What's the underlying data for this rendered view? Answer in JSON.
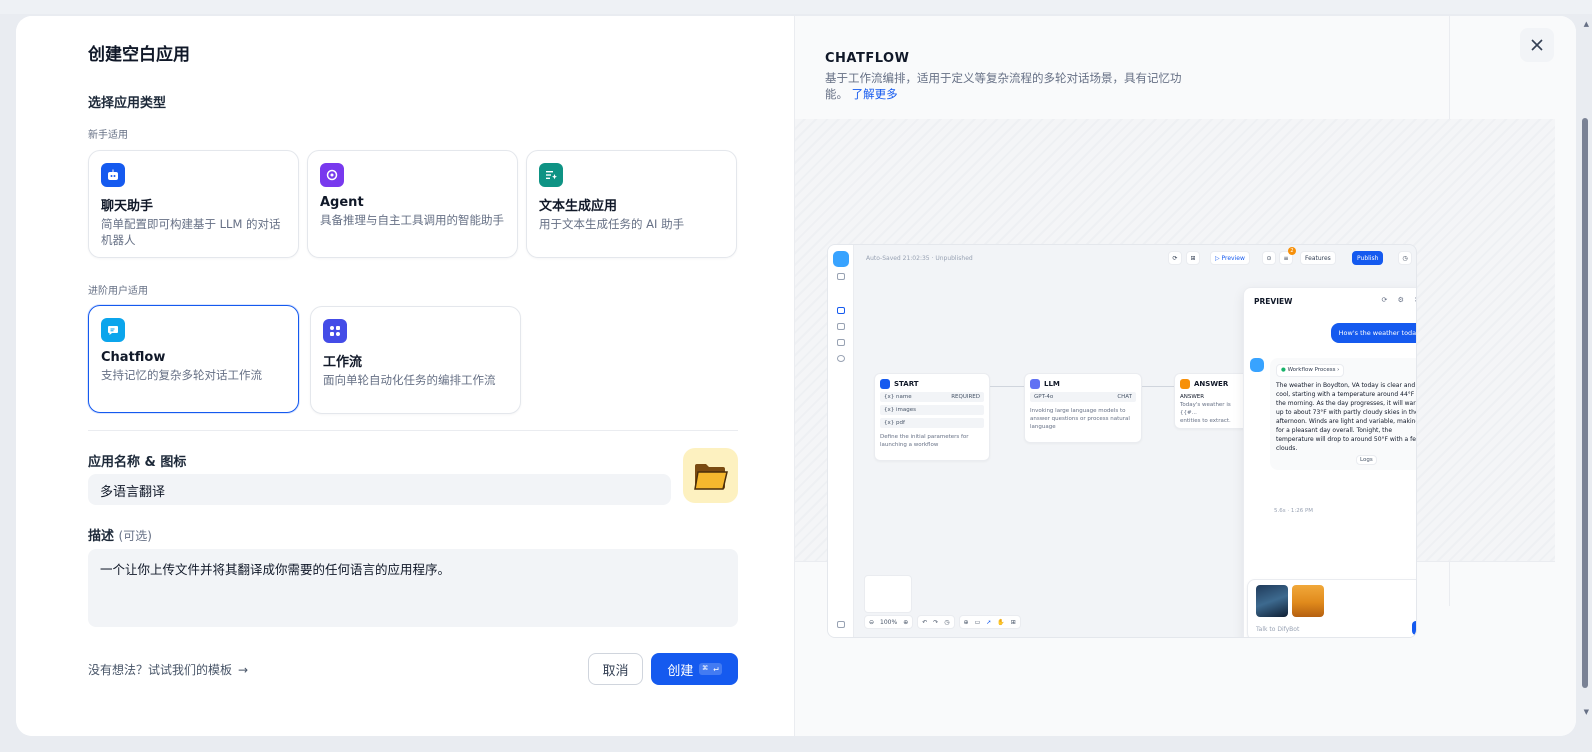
{
  "dialog": {
    "title": "创建空白应用",
    "app_type_label": "选择应用类型",
    "beginner_label": "新手适用",
    "advanced_label": "进阶用户适用",
    "beginner_cards": [
      {
        "title": "聊天助手",
        "desc": "简单配置即可构建基于 LLM 的对话机器人",
        "icon": "chat-bot-icon",
        "color": "#155aef"
      },
      {
        "title": "Agent",
        "desc": "具备推理与自主工具调用的智能助手",
        "icon": "agent-icon",
        "color": "#7839ee"
      },
      {
        "title": "文本生成应用",
        "desc": "用于文本生成任务的 AI 助手",
        "icon": "text-generation-icon",
        "color": "#0e9384"
      }
    ],
    "advanced_cards": [
      {
        "title": "Chatflow",
        "desc": "支持记忆的复杂多轮对话工作流",
        "icon": "chatflow-icon",
        "color": "#0ba5ec",
        "selected": true
      },
      {
        "title": "工作流",
        "desc": "面向单轮自动化任务的编排工作流",
        "icon": "workflow-icon",
        "color": "#444ce7",
        "selected": false
      }
    ],
    "name_label": "应用名称 & 图标",
    "name_value": "多语言翻译",
    "app_icon": "folder-icon",
    "desc_label": "描述",
    "desc_optional": "(可选)",
    "desc_value": "一个让你上传文件并将其翻译成你需要的任何语言的应用程序。",
    "template_link": "没有想法？试试我们的模板",
    "cancel": "取消",
    "create": "创建",
    "create_shortcut": "⌘ ↵"
  },
  "preview": {
    "title": "CHATFLOW",
    "desc": "基于工作流编排，适用于定义等复杂流程的多轮对话场景，具有记忆功能。",
    "learn_more": "了解更多",
    "mini": {
      "saved": "Auto-Saved 21:02:35 · Unpublished",
      "preview_btn": "▷ Preview",
      "features_btn": "Features",
      "publish_btn": "Publish",
      "badge": "2",
      "zoom": "100%",
      "nodes": {
        "start": {
          "title": "START",
          "rows": [
            [
              "{x} name",
              "REQUIRED"
            ],
            [
              "{x} images",
              ""
            ],
            [
              "{x} pdf",
              ""
            ]
          ],
          "desc": "Define the initial parameters for launching a workflow"
        },
        "llm": {
          "title": "LLM",
          "model": "GPT-4o",
          "mode": "CHAT",
          "desc": "Invoking large language models to answer questions or process natural language"
        },
        "answer": {
          "title": "ANSWER",
          "label": "ANSWER",
          "text": "Today's weather is {{#...",
          "text2": "entities to extract."
        }
      },
      "panel": {
        "title": "PREVIEW",
        "user_msg": "How's the weather today",
        "workflow_tag": "Workflow Process",
        "answer": "The weather in Boydton, VA today is clear and cool, starting with a temperature around 44°F in the morning. As the day progresses, it will warm up to about 73°F with partly cloudy skies in the afternoon. Winds are light and variable, making for a pleasant day overall. Tonight, the temperature will drop to around 50°F with a few clouds.",
        "logs": "Logs",
        "time": "5.6s · 1:26 PM",
        "placeholder": "Talk to DifyBot"
      }
    }
  }
}
